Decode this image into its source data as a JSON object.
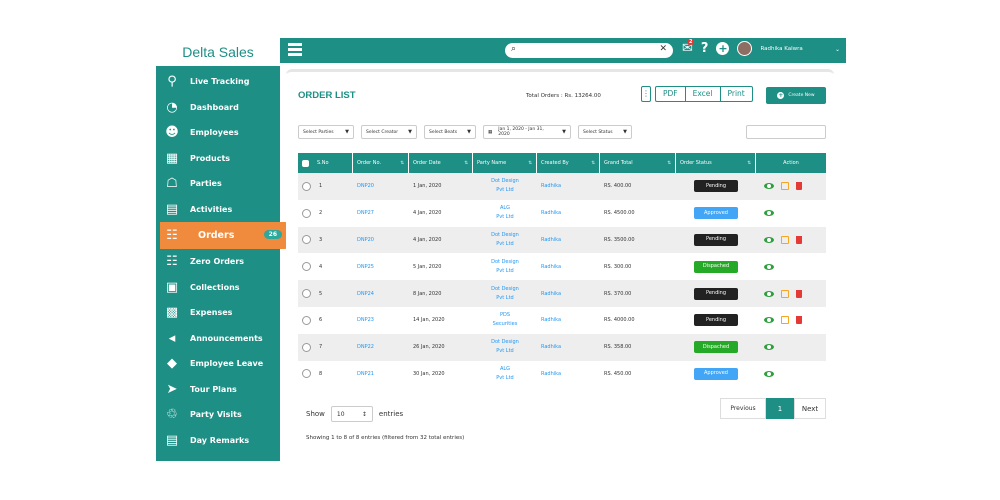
{
  "brand": "Delta Sales",
  "sidebar": {
    "items": [
      {
        "label": "Live Tracking",
        "icon": "⚲"
      },
      {
        "label": "Dashboard",
        "icon": "◔"
      },
      {
        "label": "Employees",
        "icon": "☻"
      },
      {
        "label": "Products",
        "icon": "▦"
      },
      {
        "label": "Parties",
        "icon": "☖"
      },
      {
        "label": "Activities",
        "icon": "▤"
      },
      {
        "label": "Orders",
        "icon": "☷",
        "badge": "26"
      },
      {
        "label": "Zero Orders",
        "icon": "☷"
      },
      {
        "label": "Collections",
        "icon": "▣"
      },
      {
        "label": "Expenses",
        "icon": "▩"
      },
      {
        "label": "Announcements",
        "icon": "◂"
      },
      {
        "label": "Employee Leave",
        "icon": "◆"
      },
      {
        "label": "Tour Plans",
        "icon": "➤"
      },
      {
        "label": "Party Visits",
        "icon": "♲"
      },
      {
        "label": "Day Remarks",
        "icon": "▤"
      }
    ]
  },
  "topbar": {
    "notifications": "2",
    "help": "?",
    "add": "+",
    "user": "Radhika Kalwra"
  },
  "page": {
    "title": "ORDER LIST",
    "total": "Total Orders : Rs. 13264.00",
    "buttons": {
      "pdf": "PDF",
      "excel": "Excel",
      "print": "Print",
      "create": "Create New"
    },
    "filters": {
      "parties": "Select Parties",
      "creator": "Select Creator",
      "beats": "Select Beats",
      "date": "Jan 1, 2020 - Jan 31, 2020",
      "status": "Select Status"
    }
  },
  "table": {
    "headers": [
      "S.No",
      "Order No.",
      "Order Date",
      "Party Name",
      "Created By",
      "Grand Total",
      "Order Status",
      "Action"
    ],
    "rows": [
      {
        "sno": "1",
        "order": "DNP20",
        "date": "1 Jan, 2020",
        "party1": "Dot Design",
        "party2": "Pvt Ltd",
        "by": "Radhika",
        "total": "RS. 400.00",
        "status": "Pending",
        "edit": true
      },
      {
        "sno": "2",
        "order": "DNP27",
        "date": "4 Jan, 2020",
        "party1": "ALG",
        "party2": "Pvt Ltd",
        "by": "Radhika",
        "total": "RS. 4500.00",
        "status": "Approved",
        "edit": false
      },
      {
        "sno": "3",
        "order": "DNP20",
        "date": "4 Jan, 2020",
        "party1": "Dot Design",
        "party2": "Pvt Ltd",
        "by": "Radhika",
        "total": "RS. 3500.00",
        "status": "Pending",
        "edit": true
      },
      {
        "sno": "4",
        "order": "DNP25",
        "date": "5 Jan, 2020",
        "party1": "Dot Design",
        "party2": "Pvt Ltd",
        "by": "Radhika",
        "total": "RS. 300.00",
        "status": "Dispached",
        "edit": false
      },
      {
        "sno": "5",
        "order": "DNP24",
        "date": "8 Jan, 2020",
        "party1": "Dot Design",
        "party2": "Pvt Ltd",
        "by": "Radhika",
        "total": "RS. 370.00",
        "status": "Pending",
        "edit": true
      },
      {
        "sno": "6",
        "order": "DNP23",
        "date": "14 Jan, 2020",
        "party1": "PDS",
        "party2": "Securities",
        "by": "Radhika",
        "total": "RS. 4000.00",
        "status": "Pending",
        "edit": true
      },
      {
        "sno": "7",
        "order": "DNP22",
        "date": "26 Jan, 2020",
        "party1": "Dot Design",
        "party2": "Pvt Ltd",
        "by": "Radhika",
        "total": "RS. 358.00",
        "status": "Dispached",
        "edit": false
      },
      {
        "sno": "8",
        "order": "DNP21",
        "date": "30 Jan, 2020",
        "party1": "ALG",
        "party2": "Pvt Ltd",
        "by": "Radhika",
        "total": "RS. 450.00",
        "status": "Approved",
        "edit": false
      }
    ]
  },
  "footer": {
    "show": "Show",
    "entries_value": "10",
    "entries": "entries",
    "info": "Showing 1 to 8 of 8 entries (filtered from 32 total entries)",
    "prev": "Previous",
    "page": "1",
    "next": "Next"
  }
}
